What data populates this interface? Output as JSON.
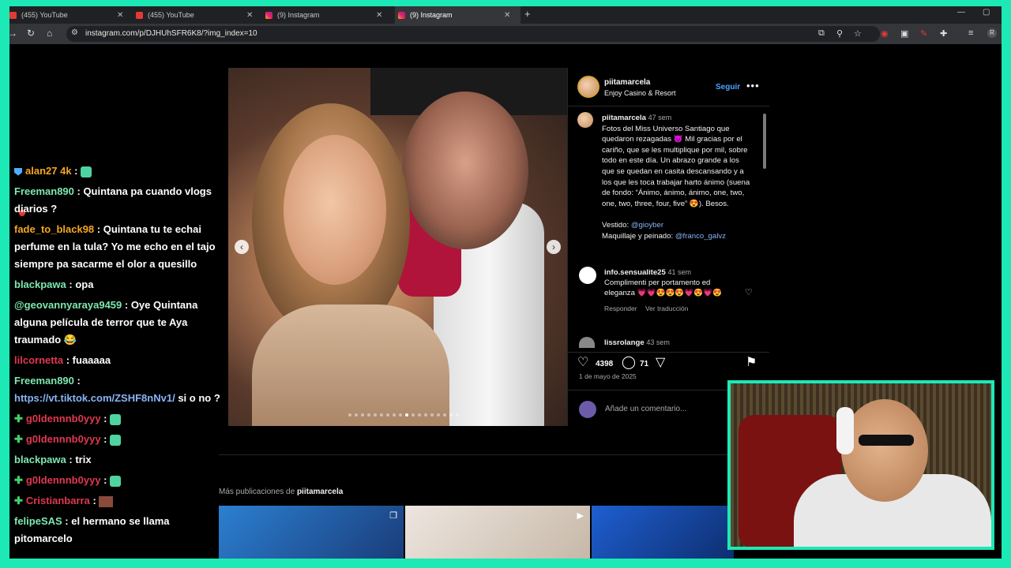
{
  "browser": {
    "tabs": [
      {
        "title": "(455) YouTube",
        "type": "youtube",
        "active": false
      },
      {
        "title": "(455) YouTube",
        "type": "youtube",
        "active": false
      },
      {
        "title": "(9) Instagram",
        "type": "instagram",
        "active": false
      },
      {
        "title": "(9) Instagram",
        "type": "instagram",
        "active": true
      }
    ],
    "url": "instagram.com/p/DJHUhSFR6K8/?img_index=10"
  },
  "post": {
    "username": "piitamarcela",
    "location": "Enjoy Casino & Resort",
    "follow_label": "Seguir",
    "caption_user": "piitamarcela",
    "caption_time": "47 sem",
    "caption_text": "Fotos del Miss Universo Santiago que quedaron rezagadas 😈 Mil gracias por el cariño, que se les multiplique por mil, sobre todo en este día. Un abrazo grande a los que se quedan en casita descansando y a los que les toca trabajar harto ánimo (suena de fondo: “Ánimo, ánimo, ánimo, one, two, one, two, three, four, five” 😍). Besos.",
    "vestido_label": "Vestido:",
    "vestido_mention": "@gioyber",
    "maquillaje_label": "Maquillaje y peinado:",
    "maquillaje_mention": "@franco_galvz",
    "comment_user": "info.sensualite25",
    "comment_time": "41 sem",
    "comment_text": "Complimenti per portamento ed eleganza 💗💗😍😍😍💗😍💗😍",
    "reply_label": "Responder",
    "translate_label": "Ver traducción",
    "next_comment_user": "lissrolange",
    "next_comment_time": "43 sem",
    "likes": "4398",
    "comments": "71",
    "date": "1 de mayo de 2025",
    "add_comment_placeholder": "Añade un comentario...",
    "more_posts_prefix": "Más publicaciones de",
    "more_posts_user": "piitamarcela",
    "carousel_index": 10,
    "carousel_total": 18
  },
  "chat": [
    {
      "badge": "shield",
      "user": "alan27 4k",
      "color": "#f5a623",
      "text": ":",
      "emoji": true
    },
    {
      "badge": "",
      "user": "Freeman890",
      "color": "#7ee8b0",
      "text": ": Quintana pa cuando vlogs diarios ?"
    },
    {
      "badge": "",
      "user": "fade_to_black98",
      "color": "#f5a623",
      "text": ": Quintana tu te echai perfume en la tula? Yo me echo en el tajo siempre pa sacarme el olor a quesillo"
    },
    {
      "badge": "",
      "user": "blackpawa",
      "color": "#7ee8b0",
      "text": ": opa"
    },
    {
      "badge": "",
      "user": "@geovannyaraya9459",
      "color": "#7ee8b0",
      "text": ": Oye Quintana alguna película de terror que te Aya traumado 😂"
    },
    {
      "badge": "",
      "user": "lilcornetta",
      "color": "#e0384f",
      "text": ": fuaaaaa"
    },
    {
      "badge": "",
      "user": "Freeman890",
      "color": "#7ee8b0",
      "text": ":",
      "link": "https://vt.tiktok.com/ZSHF8nNv1/",
      "after": " si o no ?"
    },
    {
      "badge": "plus",
      "user": "g0ldennnb0yyy",
      "color": "#e0384f",
      "text": ":",
      "emoji": true
    },
    {
      "badge": "plus",
      "user": "g0ldennnb0yyy",
      "color": "#e0384f",
      "text": ":",
      "emoji": true
    },
    {
      "badge": "",
      "user": "blackpawa",
      "color": "#7ee8b0",
      "text": ": trix"
    },
    {
      "badge": "plus",
      "user": "g0ldennnb0yyy",
      "color": "#e0384f",
      "text": ":",
      "emoji": true
    },
    {
      "badge": "plus",
      "user": "Cristianbarra",
      "color": "#e0384f",
      "text": ":",
      "img": true
    },
    {
      "badge": "",
      "user": "felipeSAS",
      "color": "#7ee8b0",
      "text": ": el hermano se llama pitomarcelo"
    }
  ],
  "colors": {
    "accent": "#1de9b6",
    "link": "#8ab4f8",
    "follow": "#4da3ff"
  }
}
